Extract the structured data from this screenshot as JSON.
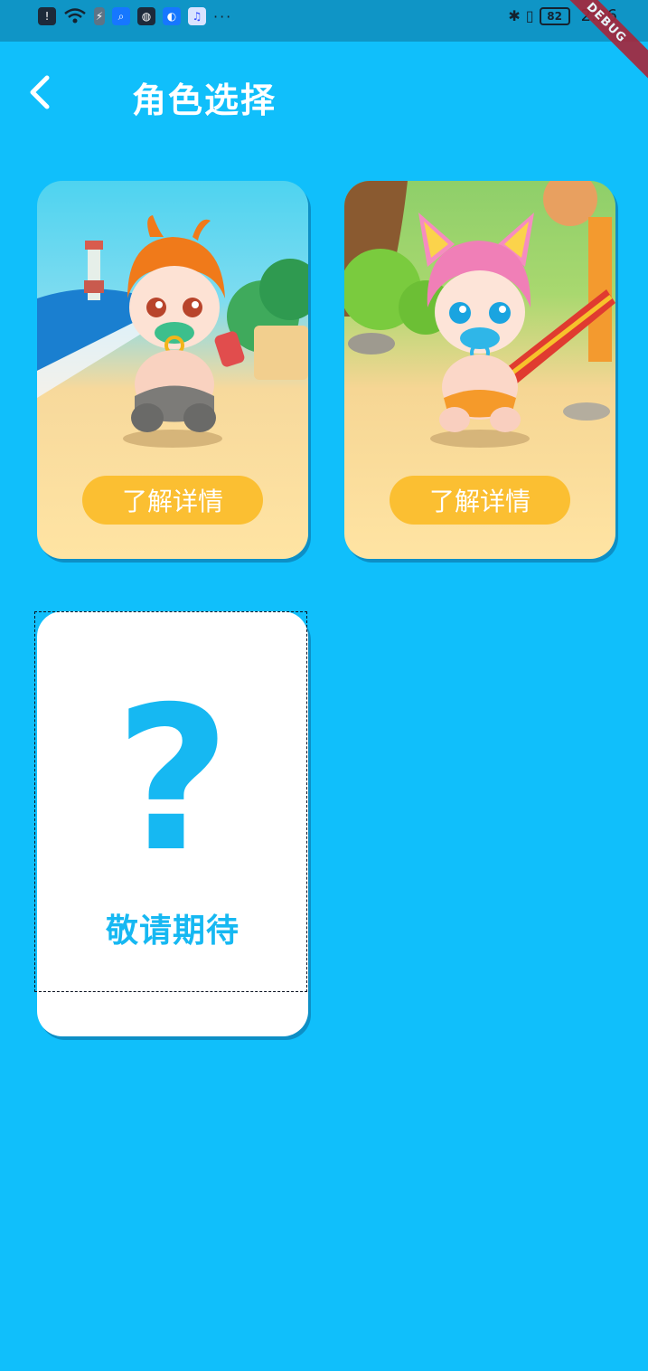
{
  "status_bar": {
    "battery": "82",
    "time": "2:26",
    "more": "···"
  },
  "debug_ribbon": "DEBUG",
  "app_bar": {
    "title": "角色选择"
  },
  "characters": [
    {
      "detail_label": "了解详情",
      "theme": "boy-on-beach"
    },
    {
      "detail_label": "了解详情",
      "theme": "girl-at-playground"
    }
  ],
  "placeholder_card": {
    "symbol": "?",
    "label": "敬请期待"
  },
  "colors": {
    "background": "#10bffb",
    "status_bar": "#0f95c6",
    "button": "#fbbf32",
    "accent_text": "#16b8f2"
  }
}
